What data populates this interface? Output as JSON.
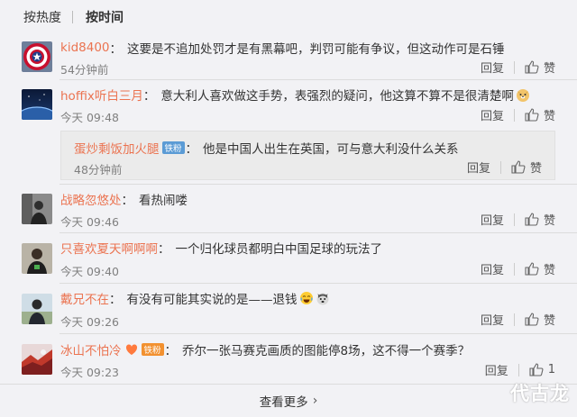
{
  "sort": {
    "hot": "按热度",
    "time": "按时间"
  },
  "actions": {
    "reply": "回复",
    "like": "赞"
  },
  "comments": [
    {
      "user": "kid8400",
      "text": "这要是不追加处罚才是有黑幕吧，判罚可能有争议，但这动作可是石锤",
      "time": "54分钟前",
      "like_count": ""
    },
    {
      "user": "hoffix听白三月",
      "text": "意大利人喜欢做这手势，表强烈的疑问，他这算不算不是很清楚啊",
      "time": "今天 09:48",
      "like_count": ""
    },
    {
      "user": "战略忽悠处",
      "text": "看热闹喽",
      "time": "今天 09:46",
      "like_count": ""
    },
    {
      "user": "只喜欢夏天啊啊啊",
      "text": "一个归化球员都明白中国足球的玩法了",
      "time": "今天 09:40",
      "like_count": ""
    },
    {
      "user": "戴兄不在",
      "text": "有没有可能其实说的是——退钱",
      "time": "今天 09:26",
      "like_count": ""
    },
    {
      "user": "冰山不怕冷",
      "text": "乔尔一张马赛克画质的图能停8场，这不得一个赛季？",
      "time": "今天 09:23",
      "like_count": "1"
    }
  ],
  "sub_reply": {
    "user": "蛋炒剩饭加火腿",
    "badge": "铁粉",
    "text": "他是中国人出生在英国，可与意大利没什么关系",
    "time": "48分钟前"
  },
  "last_badge": "铁粉",
  "more": "查看更多",
  "watermark": "代古龙",
  "colors": {
    "username": "#eb7350",
    "background": "#f2f2f5",
    "badge_blue": "#5b9bd5",
    "badge_orange": "#f29130"
  }
}
